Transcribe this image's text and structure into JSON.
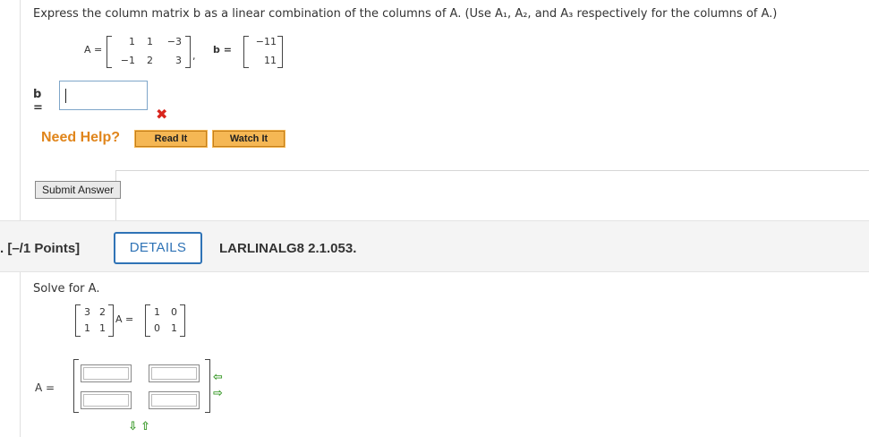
{
  "question1": {
    "prompt": "Express the column matrix b as a linear combination of the columns of A. (Use A₁, A₂, and A₃ respectively for the columns of A.)",
    "matrix_A": {
      "label": "A =",
      "rows": [
        [
          "1",
          "1",
          "−3"
        ],
        [
          "−1",
          "2",
          "3"
        ]
      ],
      "trailing": ","
    },
    "matrix_b": {
      "label": "b =",
      "rows": [
        [
          "−11"
        ],
        [
          "11"
        ]
      ]
    },
    "answer": {
      "label": "b =",
      "value": "",
      "status_icon": "x-mark-icon",
      "status_color": "#d9251d"
    },
    "need_help": "Need Help?",
    "read_it": "Read It",
    "watch_it": "Watch It",
    "submit": "Submit Answer"
  },
  "question2_header": {
    "number": ". [–/1 Points]",
    "details": "DETAILS",
    "code": "LARLINALG8 2.1.053."
  },
  "question2": {
    "prompt": "Solve for A.",
    "left_matrix": [
      [
        "3",
        "2"
      ],
      [
        "1",
        "1"
      ]
    ],
    "equation_mid": "A =",
    "right_matrix": [
      [
        "1",
        "0"
      ],
      [
        "0",
        "1"
      ]
    ],
    "answer_label": "A =",
    "answer_cells": [
      [
        "",
        ""
      ],
      [
        "",
        ""
      ]
    ],
    "arrows": {
      "remove_column": "⇦",
      "add_column": "⇨",
      "remove_row": "⇩",
      "add_row": "⇧"
    }
  },
  "colors": {
    "accent_blue": "#2f73b6",
    "help_orange": "#e0851b",
    "help_button": "#f5b754",
    "arrow_green": "#3a9a2a"
  }
}
